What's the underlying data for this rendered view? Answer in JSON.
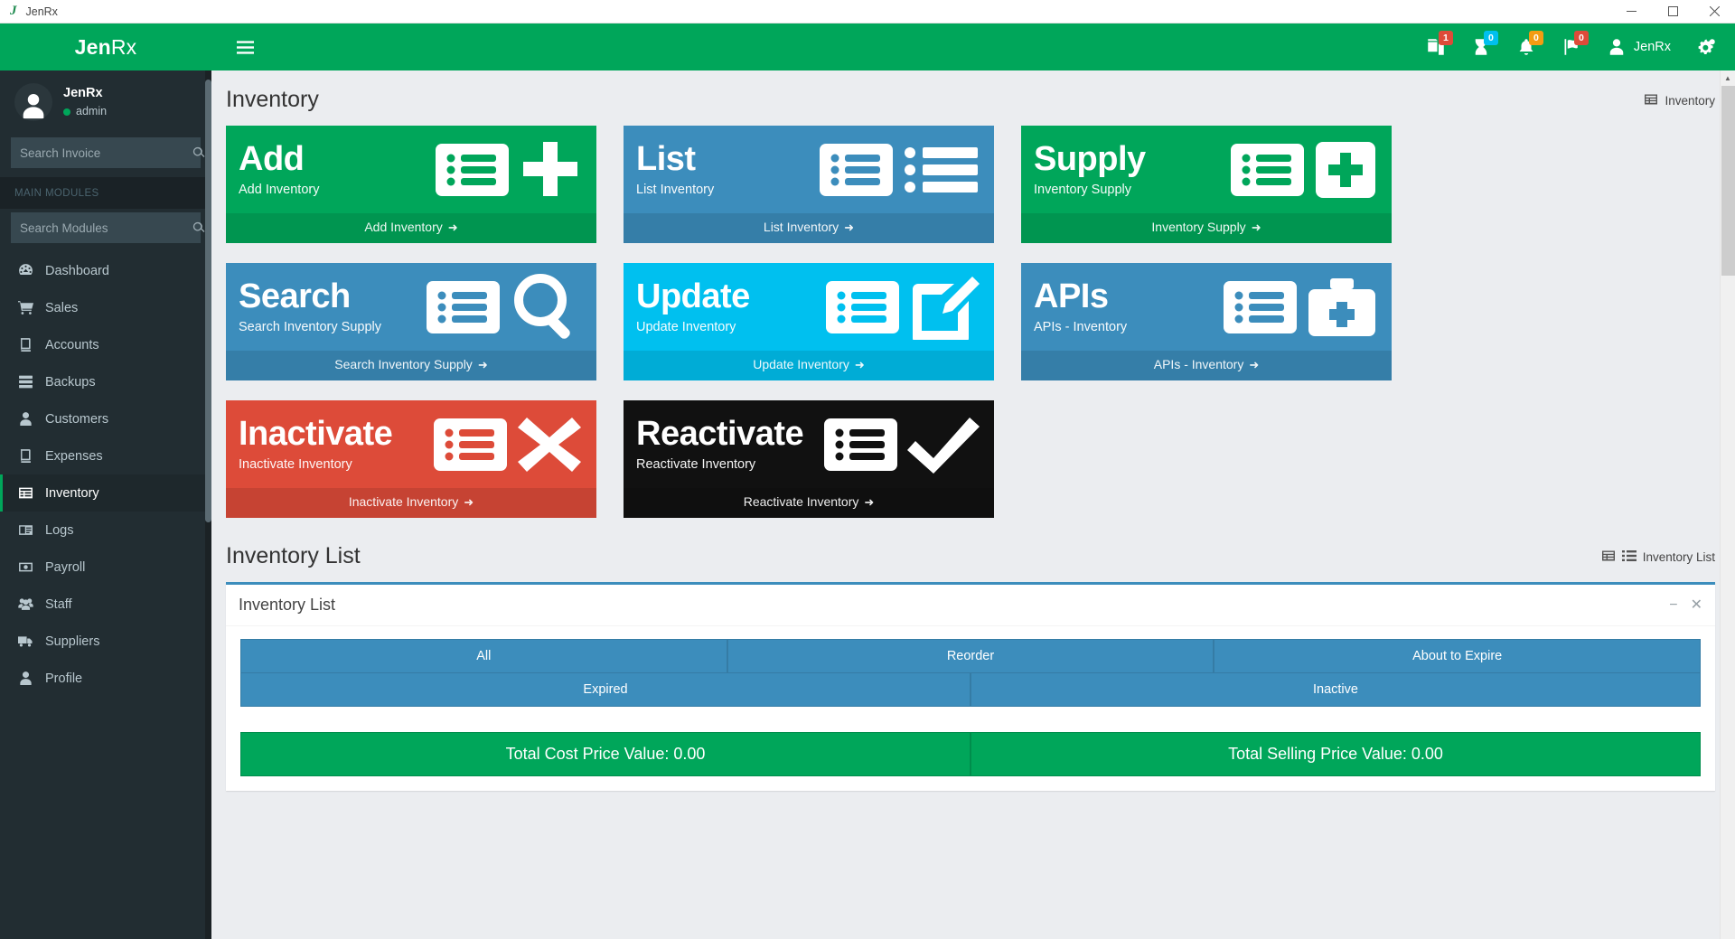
{
  "window": {
    "app_icon": "jenrx-logo-icon",
    "title": "JenRx",
    "minimize": "minimize-icon",
    "maximize": "maximize-icon",
    "close": "close-icon"
  },
  "sidebar": {
    "brand_bold": "Jen",
    "brand_light": "Rx",
    "user": {
      "name": "JenRx",
      "role": "admin"
    },
    "invoice_search": {
      "placeholder": "Search Invoice",
      "value": ""
    },
    "section_header": "MAIN MODULES",
    "module_search": {
      "placeholder": "Search Modules",
      "value": ""
    },
    "items": [
      {
        "label": "Dashboard",
        "icon": "dashboard-icon",
        "active": false
      },
      {
        "label": "Sales",
        "icon": "cart-icon",
        "active": false
      },
      {
        "label": "Accounts",
        "icon": "book-icon",
        "active": false
      },
      {
        "label": "Backups",
        "icon": "server-icon",
        "active": false
      },
      {
        "label": "Customers",
        "icon": "user-icon",
        "active": false
      },
      {
        "label": "Expenses",
        "icon": "book-icon",
        "active": false
      },
      {
        "label": "Inventory",
        "icon": "table-icon",
        "active": true
      },
      {
        "label": "Logs",
        "icon": "id-card-icon",
        "active": false
      },
      {
        "label": "Payroll",
        "icon": "money-icon",
        "active": false
      },
      {
        "label": "Staff",
        "icon": "users-icon",
        "active": false
      },
      {
        "label": "Suppliers",
        "icon": "truck-icon",
        "active": false
      },
      {
        "label": "Profile",
        "icon": "user-circle-icon",
        "active": false
      }
    ]
  },
  "topbar": {
    "menu_toggle": "hamburger-icon",
    "icons": [
      {
        "name": "documents-icon",
        "badge": "1",
        "badge_color": "#dd4b39"
      },
      {
        "name": "hourglass-icon",
        "badge": "0",
        "badge_color": "#00c0ef"
      },
      {
        "name": "bell-icon",
        "badge": "0",
        "badge_color": "#f39c12"
      },
      {
        "name": "flag-icon",
        "badge": "0",
        "badge_color": "#dd4b39"
      }
    ],
    "user_label": "JenRx",
    "settings_icon": "gears-icon"
  },
  "page": {
    "title": "Inventory",
    "breadcrumb": "Inventory",
    "breadcrumb_icon": "table-icon"
  },
  "cards": [
    {
      "big": "Add",
      "sub": "Add Inventory",
      "foot": "Add Inventory",
      "color": "#00a65a",
      "theme": "cg-green",
      "icons": [
        "list-icon",
        "plus-icon"
      ]
    },
    {
      "big": "List",
      "sub": "List Inventory",
      "foot": "List Inventory",
      "color": "#3c8dbc",
      "theme": "cg-blue",
      "icons": [
        "list-icon",
        "bullet-list-icon"
      ]
    },
    {
      "big": "Supply",
      "sub": "Inventory Supply",
      "foot": "Inventory Supply",
      "color": "#00a65a",
      "theme": "cg-green",
      "icons": [
        "list-icon",
        "plus-square-icon"
      ]
    },
    {
      "big": "Search",
      "sub": "Search Inventory Supply",
      "foot": "Search Inventory Supply",
      "color": "#3c8dbc",
      "theme": "cg-blue",
      "icons": [
        "list-icon",
        "magnifier-icon"
      ]
    },
    {
      "big": "Update",
      "sub": "Update Inventory",
      "foot": "Update Inventory",
      "color": "#00c0ef",
      "theme": "cg-aqua",
      "icons": [
        "list-icon",
        "pencil-square-icon"
      ]
    },
    {
      "big": "APIs",
      "sub": "APIs - Inventory",
      "foot": "APIs - Inventory",
      "color": "#3c8dbc",
      "theme": "cg-blue",
      "icons": [
        "list-icon",
        "medkit-icon"
      ]
    },
    {
      "big": "Inactivate",
      "sub": "Inactivate Inventory",
      "foot": "Inactivate Inventory",
      "color": "#dd4b39",
      "theme": "cg-red",
      "icons": [
        "list-icon",
        "cross-icon"
      ]
    },
    {
      "big": "Reactivate",
      "sub": "Reactivate Inventory",
      "foot": "Reactivate Inventory",
      "color": "#111111",
      "theme": "cg-black",
      "icons": [
        "list-icon",
        "check-icon"
      ]
    }
  ],
  "list_section": {
    "title": "Inventory List",
    "breadcrumb": "Inventory List",
    "breadcrumb_icons": [
      "table-icon",
      "list-icon"
    ],
    "panel_title": "Inventory List",
    "collapse_icon": "minus-icon",
    "close_icon": "close-icon",
    "tabs_row1": [
      "All",
      "Reorder",
      "About to Expire"
    ],
    "tabs_row2": [
      "Expired",
      "Inactive"
    ],
    "totals": [
      "Total Cost Price Value: 0.00",
      "Total Selling Price Value: 0.00"
    ]
  }
}
